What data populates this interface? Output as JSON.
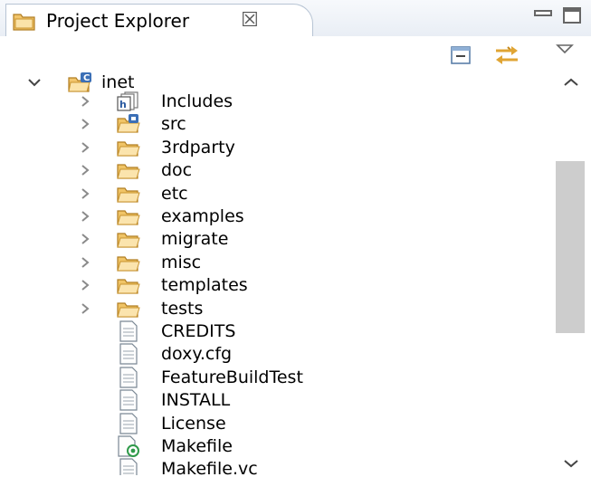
{
  "view": {
    "title": "Project Explorer",
    "close_symbol": "☒",
    "accent_color": "#e8a33d"
  },
  "toolbar": {
    "buttons": [
      {
        "name": "collapse-all-icon"
      },
      {
        "name": "link-with-editor-icon"
      },
      {
        "name": "view-menu-icon"
      }
    ]
  },
  "tree": {
    "root": {
      "label": "inet",
      "expanded": true,
      "icon": "c-project-folder-icon"
    },
    "items": [
      {
        "label": "Includes",
        "type": "includes",
        "expandable": true
      },
      {
        "label": "src",
        "type": "source-folder",
        "expandable": true
      },
      {
        "label": "3rdparty",
        "type": "folder",
        "expandable": true
      },
      {
        "label": "doc",
        "type": "folder",
        "expandable": true
      },
      {
        "label": "etc",
        "type": "folder",
        "expandable": true
      },
      {
        "label": "examples",
        "type": "folder",
        "expandable": true
      },
      {
        "label": "migrate",
        "type": "folder",
        "expandable": true
      },
      {
        "label": "misc",
        "type": "folder",
        "expandable": true
      },
      {
        "label": "templates",
        "type": "folder",
        "expandable": true
      },
      {
        "label": "tests",
        "type": "folder",
        "expandable": true
      },
      {
        "label": "CREDITS",
        "type": "file",
        "expandable": false
      },
      {
        "label": "doxy.cfg",
        "type": "file",
        "expandable": false
      },
      {
        "label": "FeatureBuildTest",
        "type": "file",
        "expandable": false
      },
      {
        "label": "INSTALL",
        "type": "file",
        "expandable": false
      },
      {
        "label": "License",
        "type": "file",
        "expandable": false
      },
      {
        "label": "Makefile",
        "type": "makefile",
        "expandable": false
      },
      {
        "label": "Makefile.vc",
        "type": "file",
        "expandable": false
      }
    ]
  }
}
